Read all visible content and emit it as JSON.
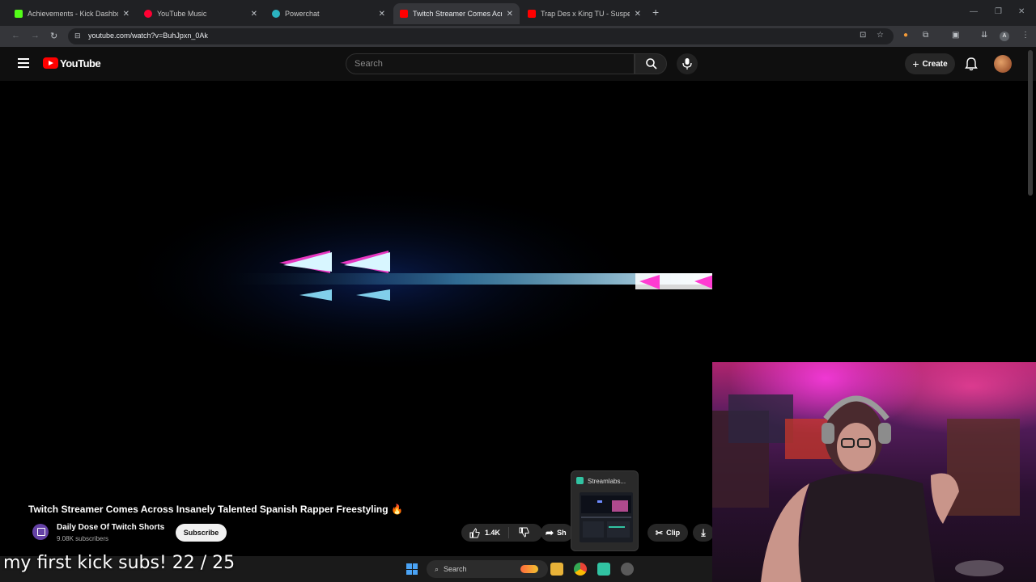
{
  "browser": {
    "tabs": [
      {
        "label": "Achievements - Kick Dashboard",
        "favicon": "kick-icon",
        "color": "#53fc18",
        "active": false
      },
      {
        "label": "YouTube Music",
        "favicon": "youtube-music-icon",
        "color": "#ff0033",
        "active": false
      },
      {
        "label": "Powerchat",
        "favicon": "powerchat-icon",
        "color": "#2bb3c0",
        "active": false
      },
      {
        "label": "Twitch Streamer Comes Across",
        "favicon": "youtube-icon",
        "color": "#ff0000",
        "active": true
      },
      {
        "label": "Trap Des x King TU - Suspect | S",
        "favicon": "youtube-icon",
        "color": "#ff0000",
        "active": false
      }
    ],
    "url": "youtube.com/watch?v=BuhJpxn_0Ak"
  },
  "youtube": {
    "logo_text": "YouTube",
    "search_placeholder": "Search",
    "create_label": "Create"
  },
  "video": {
    "title": "Twitch Streamer Comes Across Insanely Talented Spanish Rapper Freestyling",
    "title_emoji": "🔥",
    "channel": "Daily Dose Of Twitch Shorts",
    "subscribers": "9.08K subscribers",
    "subscribe_label": "Subscribe",
    "likes": "1.4K",
    "share_label": "Sh",
    "clip_label": "Clip"
  },
  "taskbar": {
    "search_label": "Search",
    "preview_title": "Streamlabs..."
  },
  "overlay": {
    "goal_text": "my first kick subs!  22 / 25"
  },
  "colors": {
    "youtube_red": "#ff0000",
    "streamlabs": "#31c3a2"
  }
}
